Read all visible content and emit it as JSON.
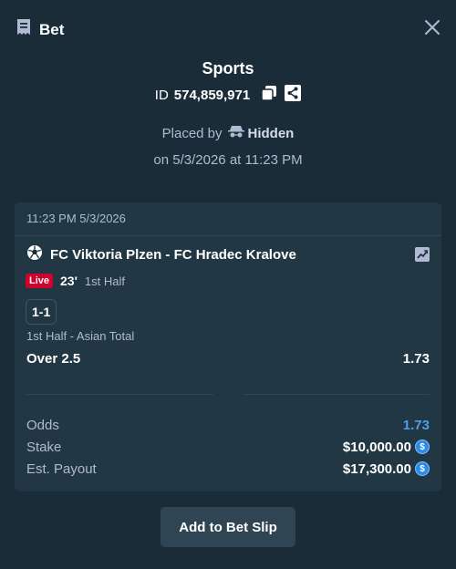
{
  "header": {
    "title": "Bet",
    "title_icon": "receipt-icon",
    "close_icon": "close-icon"
  },
  "summary_head": {
    "sport": "Sports",
    "id_label": "ID",
    "id_value": "574,859,971",
    "copy_icon": "copy-icon",
    "share_icon": "share-icon",
    "placed_by_label": "Placed by",
    "user": "Hidden",
    "user_icon": "incognito-icon",
    "date_text": "on 5/3/2026 at 11:23 PM"
  },
  "bet": {
    "timestamp": "11:23 PM 5/3/2026",
    "match": "FC Viktoria Plzen - FC Hradec Kralove",
    "sport_icon": "soccer-ball-icon",
    "stats_icon": "trend-chart-icon",
    "live_label": "Live",
    "minute": "23'",
    "period": "1st Half",
    "score": "1-1",
    "market": "1st Half - Asian Total",
    "selection": "Over 2.5",
    "selection_odds": "1.73"
  },
  "totals": {
    "odds_label": "Odds",
    "odds_value": "1.73",
    "stake_label": "Stake",
    "stake_value": "$10,000.00",
    "payout_label": "Est. Payout",
    "payout_value": "$17,300.00",
    "currency_icon": "usd-coin-icon"
  },
  "actions": {
    "add_label": "Add to Bet Slip"
  },
  "colors": {
    "background": "#1a2c38",
    "card": "#213743",
    "live": "#d0022d",
    "odds_accent": "#4f9ce8"
  }
}
